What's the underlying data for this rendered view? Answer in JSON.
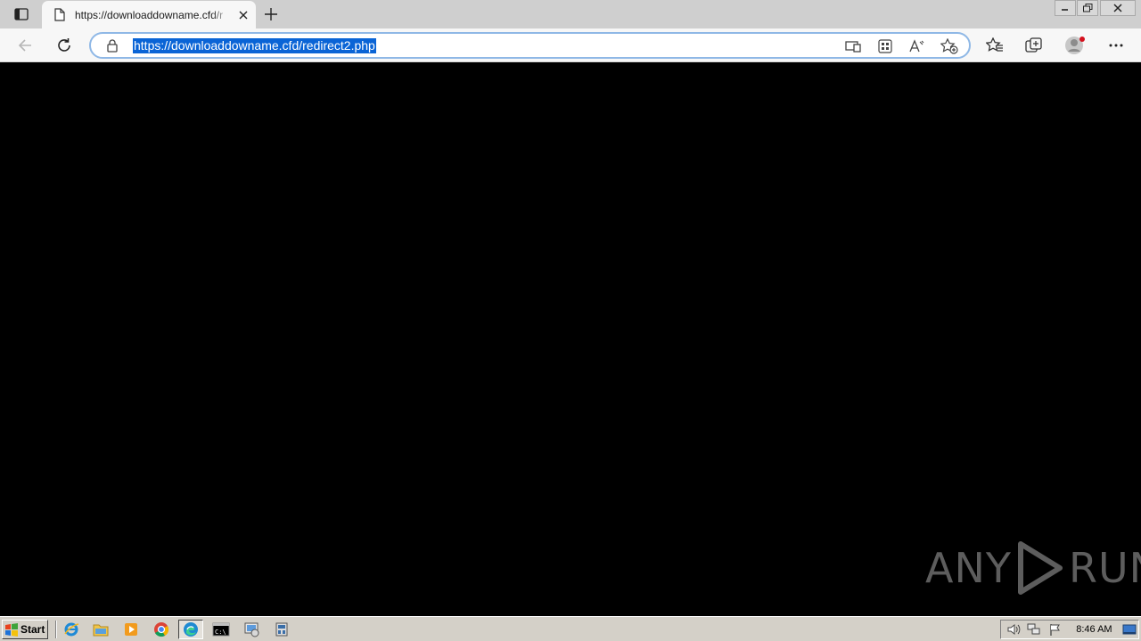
{
  "browser": {
    "tab": {
      "title": "https://downloaddowname.cfd/r"
    },
    "address_bar": {
      "url": "https://downloaddowname.cfd/redirect2.php"
    },
    "toolbar_icons": [
      "immersive-reader-icon",
      "apps-icon",
      "read-aloud-icon",
      "add-favorite-icon",
      "favorites-icon",
      "collections-icon",
      "profile-icon",
      "more-icon"
    ]
  },
  "page": {
    "background": "#000000",
    "watermark": {
      "left_text": "ANY",
      "right_text": "RUN"
    }
  },
  "taskbar": {
    "start_label": "Start",
    "apps": [
      "internet-explorer-icon",
      "file-explorer-icon",
      "media-player-icon",
      "chrome-icon",
      "edge-icon",
      "cmd-icon",
      "control-panel-icon",
      "network-config-icon"
    ],
    "active_app": "edge-icon",
    "clock": "8:46 AM"
  },
  "colors": {
    "selection": "#0a64d6",
    "omnibox_border": "#8fb8e6",
    "taskbar": "#d4d0c8"
  }
}
